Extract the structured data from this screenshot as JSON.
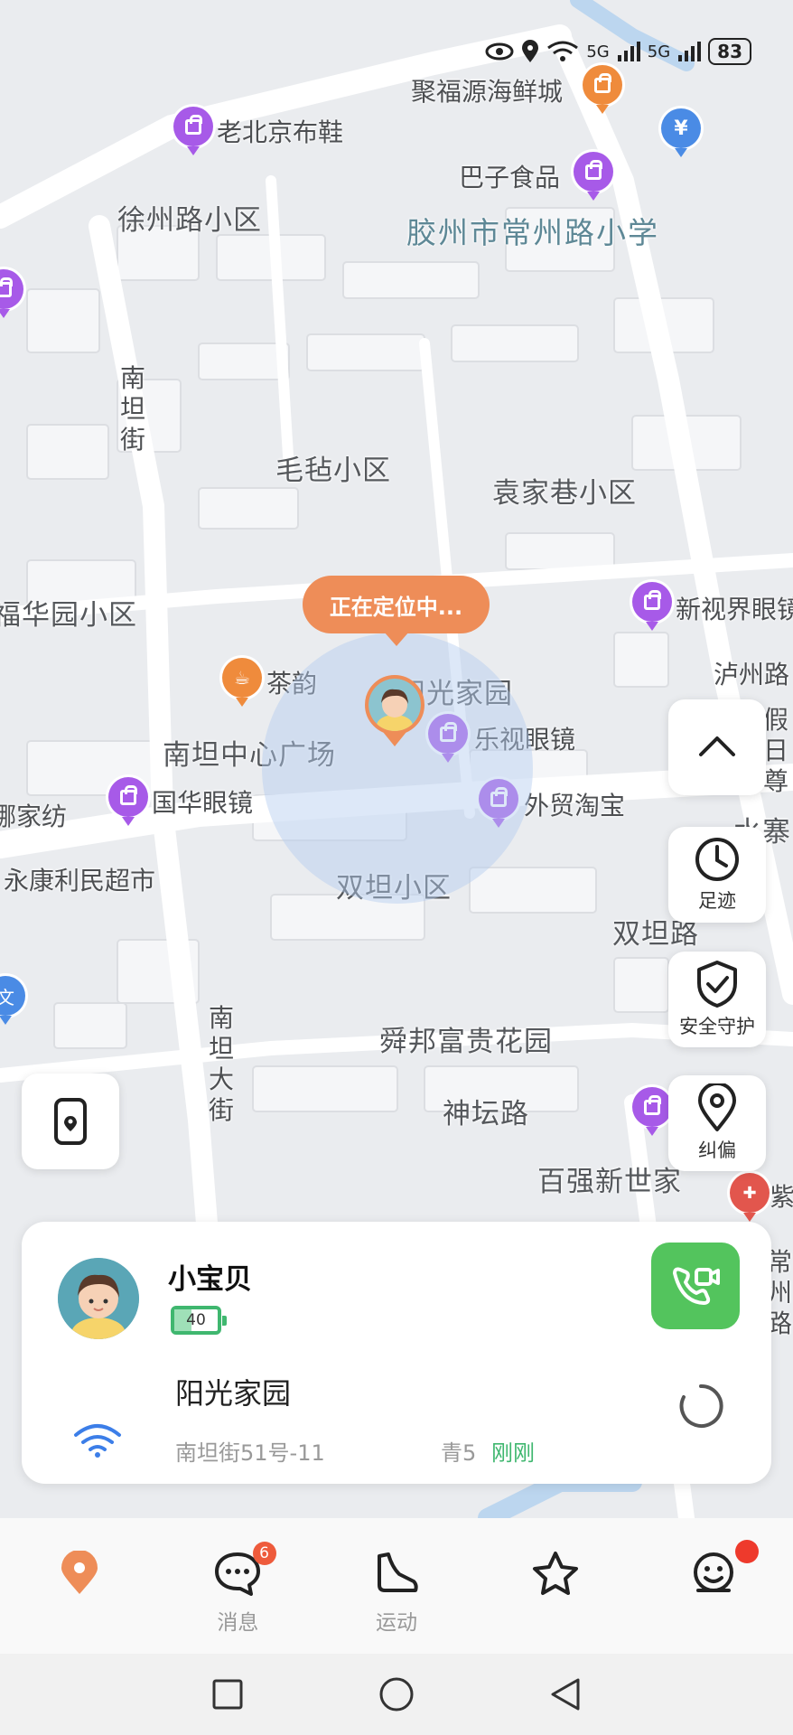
{
  "status_bar": {
    "net1": "5G",
    "net2": "5G",
    "battery": "83"
  },
  "map": {
    "labels": {
      "jufuyuan": "聚福源海鲜城",
      "laobeijing": "老北京布鞋",
      "bazi": "巴子食品",
      "xuzhoulu": "徐州路小区",
      "school": "胶州市常州路小学",
      "nantanjie": "南坦街",
      "maozhan": "毛毡小区",
      "yuanjiaxiang": "袁家巷小区",
      "fuhuayuan": "福华园小区",
      "xinshijie": "新视界眼镜",
      "chayun": "茶韵",
      "yangguang": "阳光家园",
      "luzhou": "泸州路",
      "jiazun": "假日尊",
      "nantanzhongxin": "南坦中心广场",
      "leshi": "乐视眼镜",
      "nuojiafang": "娜家纺",
      "guohua": "国华眼镜",
      "waimao": "外贸淘宝",
      "shuijing": "水寨",
      "yongkang": "永康利民超市",
      "shuangtan": "双坦小区",
      "shuangtanroad": "双坦路",
      "wen": "文",
      "nantandajie": "南坦大街",
      "shunbang": "舜邦富贵花园",
      "shentan": "神坛路",
      "baiqiang": "百强新世家",
      "zi": "紫",
      "changzhou2": "常州路"
    },
    "locating_text": "正在定位中..."
  },
  "side_buttons": {
    "collapse": "collapse",
    "footprint": "足迹",
    "safety": "安全守护",
    "correct": "纠偏"
  },
  "card": {
    "name": "小宝贝",
    "battery_level": "40",
    "battery_fraction": 0.4,
    "place": "阳光家园",
    "address": "南坦街51号-11",
    "address2": "青5",
    "time": "刚刚"
  },
  "tabs": [
    {
      "label": "",
      "icon": "location-icon"
    },
    {
      "label": "消息",
      "icon": "message-icon",
      "badge": "6"
    },
    {
      "label": "运动",
      "icon": "shoe-icon"
    },
    {
      "label": "",
      "icon": "star-icon"
    },
    {
      "label": "",
      "icon": "robot-icon"
    }
  ],
  "colors": {
    "accent": "#ee8d58",
    "poi": "#a75ae8",
    "call": "#53c45d",
    "battery": "#3fb76f"
  }
}
